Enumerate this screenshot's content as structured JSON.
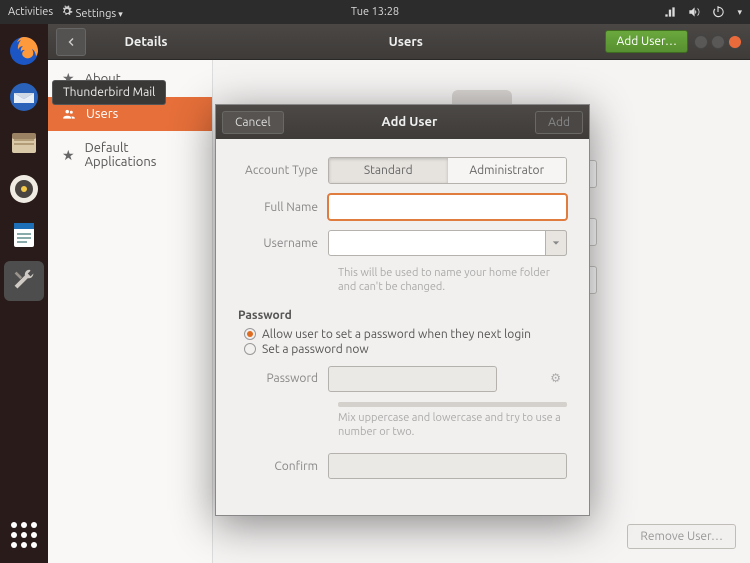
{
  "panel": {
    "activities": "Activities",
    "app_menu": "Settings",
    "clock": "Tue 13:28"
  },
  "tooltip": {
    "thunderbird": "Thunderbird Mail"
  },
  "settings": {
    "back_section": "Details",
    "page_title": "Users",
    "add_user_btn": "Add User…",
    "sidebar": {
      "about": "About",
      "users": "Users",
      "default_apps": "Default Applications"
    },
    "remove_user_btn": "Remove User…"
  },
  "dialog": {
    "cancel": "Cancel",
    "title": "Add User",
    "add": "Add",
    "account_type_label": "Account Type",
    "standard": "Standard",
    "administrator": "Administrator",
    "full_name_label": "Full Name",
    "username_label": "Username",
    "username_hint": "This will be used to name your home folder and can't be changed.",
    "password_section": "Password",
    "radio_next_login": "Allow user to set a password when they next login",
    "radio_now": "Set a password now",
    "password_label": "Password",
    "password_hint": "Mix uppercase and lowercase and try to use a number or two.",
    "confirm_label": "Confirm"
  }
}
